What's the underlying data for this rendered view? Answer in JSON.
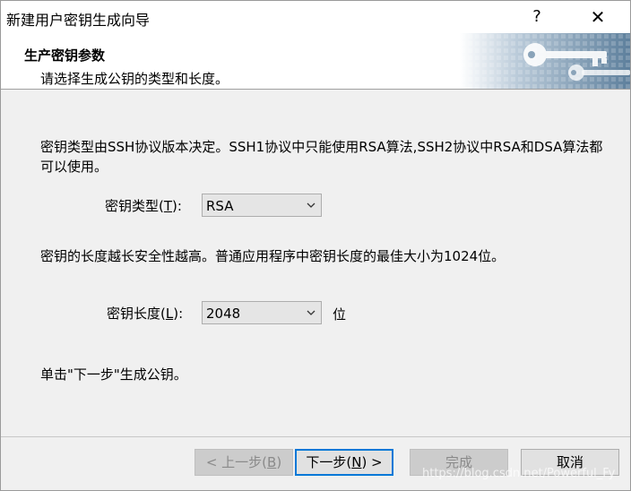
{
  "window": {
    "title": "新建用户密钥生成向导",
    "help_label": "?",
    "close_label": "✕"
  },
  "header": {
    "title": "生产密钥参数",
    "subtitle": "请选择生成公钥的类型和长度。"
  },
  "main": {
    "type_desc": "密钥类型由SSH协议版本决定。SSH1协议中只能使用RSA算法,SSH2协议中RSA和DSA算法都可以使用。",
    "key_type": {
      "label": "密钥类型(",
      "accel": "T",
      "label_end": "):",
      "value": "RSA"
    },
    "length_desc": "密钥的长度越长安全性越高。普通应用程序中密钥长度的最佳大小为1024位。",
    "key_length": {
      "label": "密钥长度(",
      "accel": "L",
      "label_end": "):",
      "value": "2048",
      "unit": "位"
    },
    "instruction": "单击\"下一步\"生成公钥。"
  },
  "footer": {
    "back": {
      "pre": "< 上一步(",
      "accel": "B",
      "post": ")",
      "enabled": false
    },
    "next": {
      "pre": "下一步(",
      "accel": "N",
      "post": ") >",
      "enabled": true
    },
    "finish": {
      "label": "完成",
      "enabled": false
    },
    "cancel": {
      "label": "取消",
      "enabled": true
    }
  },
  "watermark": "https://blog.csdn.net/Powerful_Fy",
  "colors": {
    "accent": "#0078d7",
    "header_graphic": "#6f8fa8"
  }
}
